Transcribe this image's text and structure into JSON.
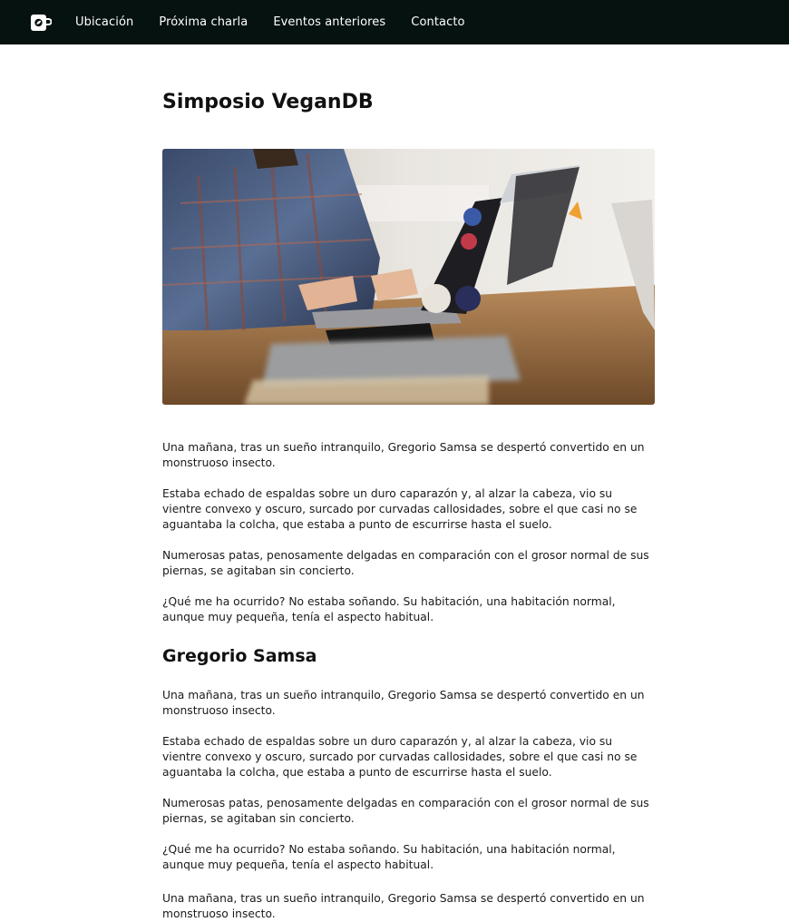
{
  "nav": {
    "logo_icon": "coffee-cup-icon",
    "items": [
      {
        "label": "Ubicación"
      },
      {
        "label": "Próxima charla"
      },
      {
        "label": "Eventos anteriores"
      },
      {
        "label": "Contacto"
      }
    ],
    "background": "#061210"
  },
  "page": {
    "title": "Simposio VeganDB",
    "hero_image": "photo-person-typing-on-laptops",
    "paragraphs": [
      "Una mañana, tras un sueño intranquilo, Gregorio Samsa se despertó convertido en un monstruoso insecto.",
      "Estaba echado de espaldas sobre un duro caparazón y, al alzar la cabeza, vio su vientre convexo y oscuro, surcado por curvadas callosidades, sobre el que casi no se aguantaba la colcha, que estaba a punto de escurrirse hasta el suelo.",
      "Numerosas patas, penosamente delgadas en comparación con el grosor normal de sus piernas, se agitaban sin concierto.",
      "¿Qué me ha ocurrido? No estaba soñando. Su habitación, una habitación normal, aunque muy pequeña, tenía el aspecto habitual."
    ],
    "section_title": "Gregorio Samsa",
    "section_paragraphs": [
      "Una mañana, tras un sueño intranquilo, Gregorio Samsa se despertó convertido en un monstruoso insecto.",
      "Estaba echado de espaldas sobre un duro caparazón y, al alzar la cabeza, vio su vientre convexo y oscuro, surcado por curvadas callosidades, sobre el que casi no se aguantaba la colcha, que estaba a punto de escurrirse hasta el suelo.",
      "Numerosas patas, penosamente delgadas en comparación con el grosor normal de sus piernas, se agitaban sin concierto.",
      "¿Qué me ha ocurrido? No estaba soñando. Su habitación, una habitación normal, aunque muy pequeña, tenía el aspecto habitual.",
      "Una mañana, tras un sueño intranquilo, Gregorio Samsa se despertó convertido en un monstruoso insecto."
    ]
  }
}
